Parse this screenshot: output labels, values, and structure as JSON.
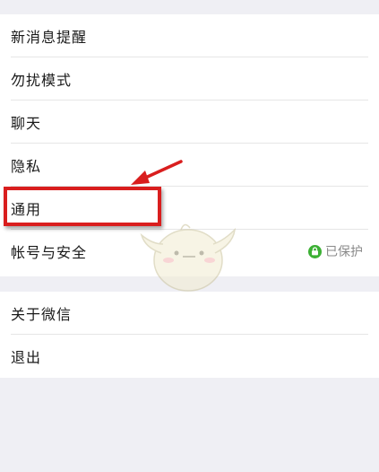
{
  "settings": {
    "items": [
      {
        "label": "新消息提醒"
      },
      {
        "label": "勿扰模式"
      },
      {
        "label": "聊天"
      },
      {
        "label": "隐私"
      },
      {
        "label": "通用"
      },
      {
        "label": "帐号与安全",
        "status": "已保护",
        "status_icon": "lock-icon"
      }
    ],
    "items2": [
      {
        "label": "关于微信"
      },
      {
        "label": "退出"
      }
    ]
  },
  "colors": {
    "background": "#efeff4",
    "annotation": "#d91e1e",
    "protected": "#3cb034"
  }
}
